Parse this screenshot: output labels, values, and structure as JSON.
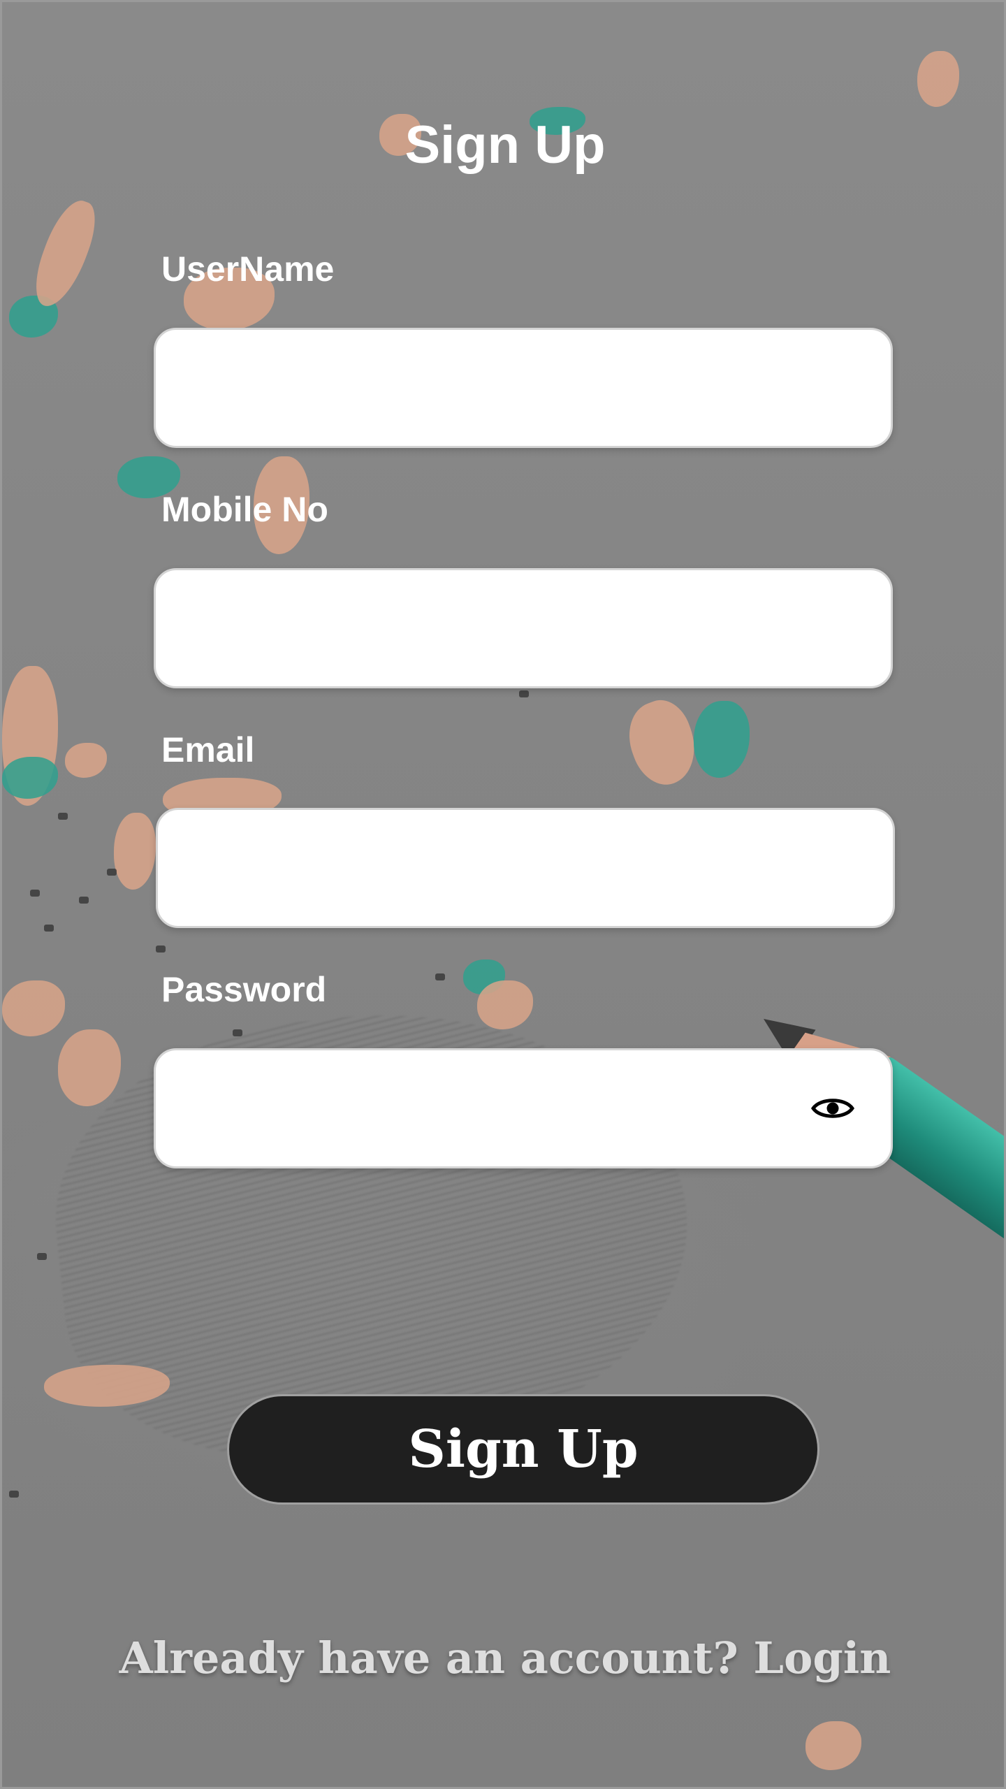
{
  "page": {
    "title": "Sign Up"
  },
  "form": {
    "fields": [
      {
        "label": "UserName",
        "value": "",
        "placeholder": ""
      },
      {
        "label": "Mobile No",
        "value": "",
        "placeholder": ""
      },
      {
        "label": "Email",
        "value": "",
        "placeholder": ""
      },
      {
        "label": "Password",
        "value": "",
        "placeholder": "",
        "icon": "eye-icon"
      }
    ],
    "submit_label": "Sign Up"
  },
  "footer": {
    "login_prompt": "Already have an account? Login"
  },
  "colors": {
    "button_background": "#1f1f1f",
    "text": "#ffffff",
    "field_background": "#ffffff"
  }
}
